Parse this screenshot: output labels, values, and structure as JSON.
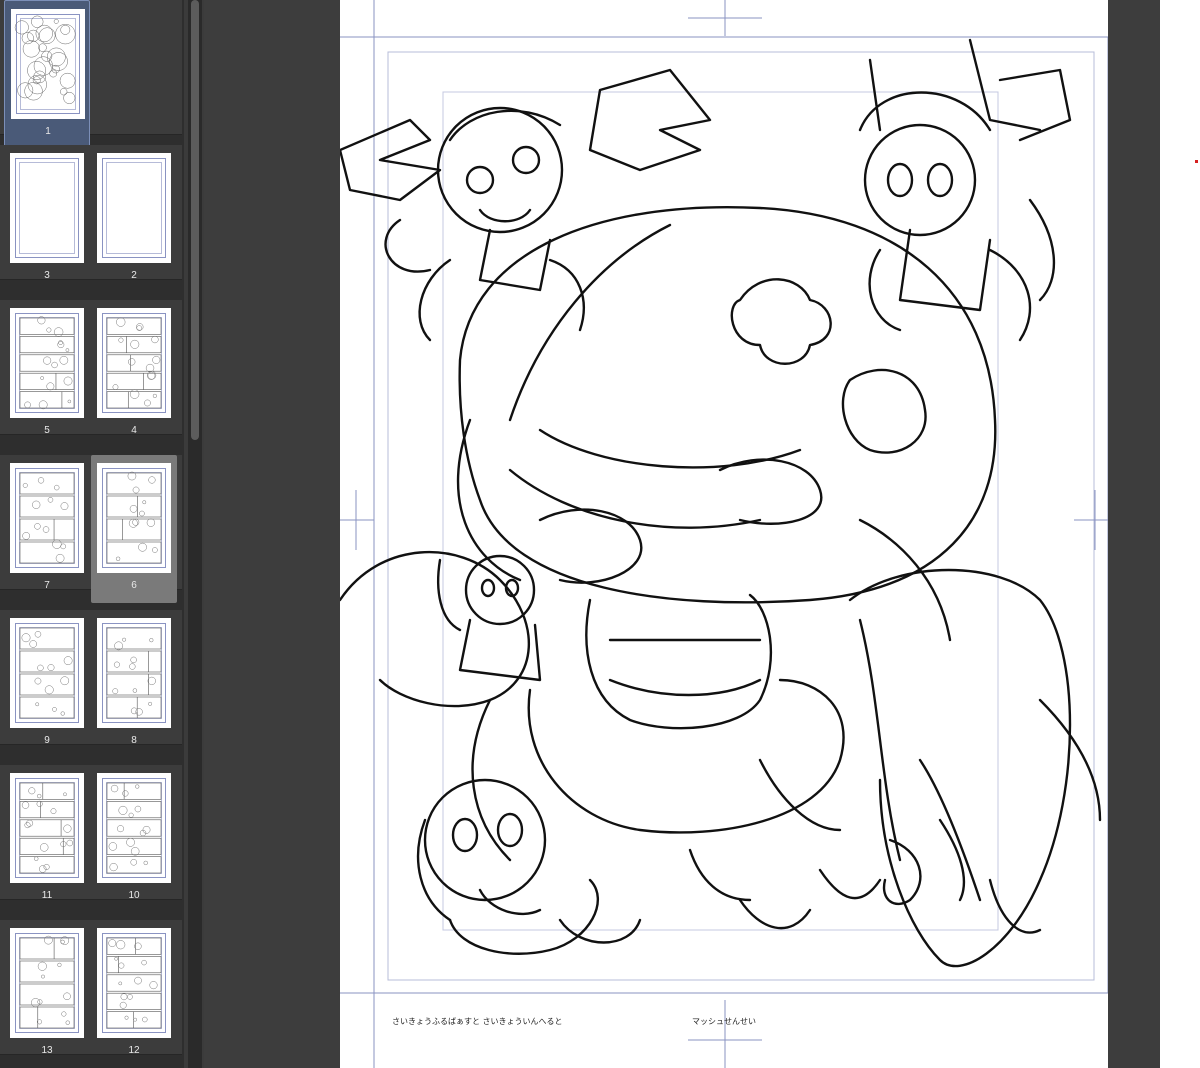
{
  "navigator": {
    "spreads": [
      {
        "pages": [
          {
            "number": "1",
            "state": "current",
            "content": "sketch"
          }
        ]
      },
      {
        "pages": [
          {
            "number": "3",
            "state": "normal",
            "content": "blank"
          },
          {
            "number": "2",
            "state": "normal",
            "content": "blank"
          }
        ]
      },
      {
        "pages": [
          {
            "number": "5",
            "state": "normal",
            "content": "panels"
          },
          {
            "number": "4",
            "state": "normal",
            "content": "panels"
          }
        ]
      },
      {
        "pages": [
          {
            "number": "7",
            "state": "normal",
            "content": "panels"
          },
          {
            "number": "6",
            "state": "selected",
            "content": "panels"
          }
        ]
      },
      {
        "pages": [
          {
            "number": "9",
            "state": "normal",
            "content": "panels"
          },
          {
            "number": "8",
            "state": "normal",
            "content": "panels"
          }
        ]
      },
      {
        "pages": [
          {
            "number": "11",
            "state": "normal",
            "content": "panels"
          },
          {
            "number": "10",
            "state": "normal",
            "content": "panels"
          }
        ]
      },
      {
        "pages": [
          {
            "number": "13",
            "state": "normal",
            "content": "panels"
          },
          {
            "number": "12",
            "state": "normal",
            "content": "panels"
          }
        ]
      }
    ]
  },
  "canvas": {
    "caption_left": "さいきょうふるばぁすと さいきょういんへると",
    "caption_center": "マッシュせんせい",
    "colors": {
      "background": "#3d3d3d",
      "paper": "#ffffff",
      "guide": "#8a93c2",
      "ink": "#111111"
    }
  }
}
